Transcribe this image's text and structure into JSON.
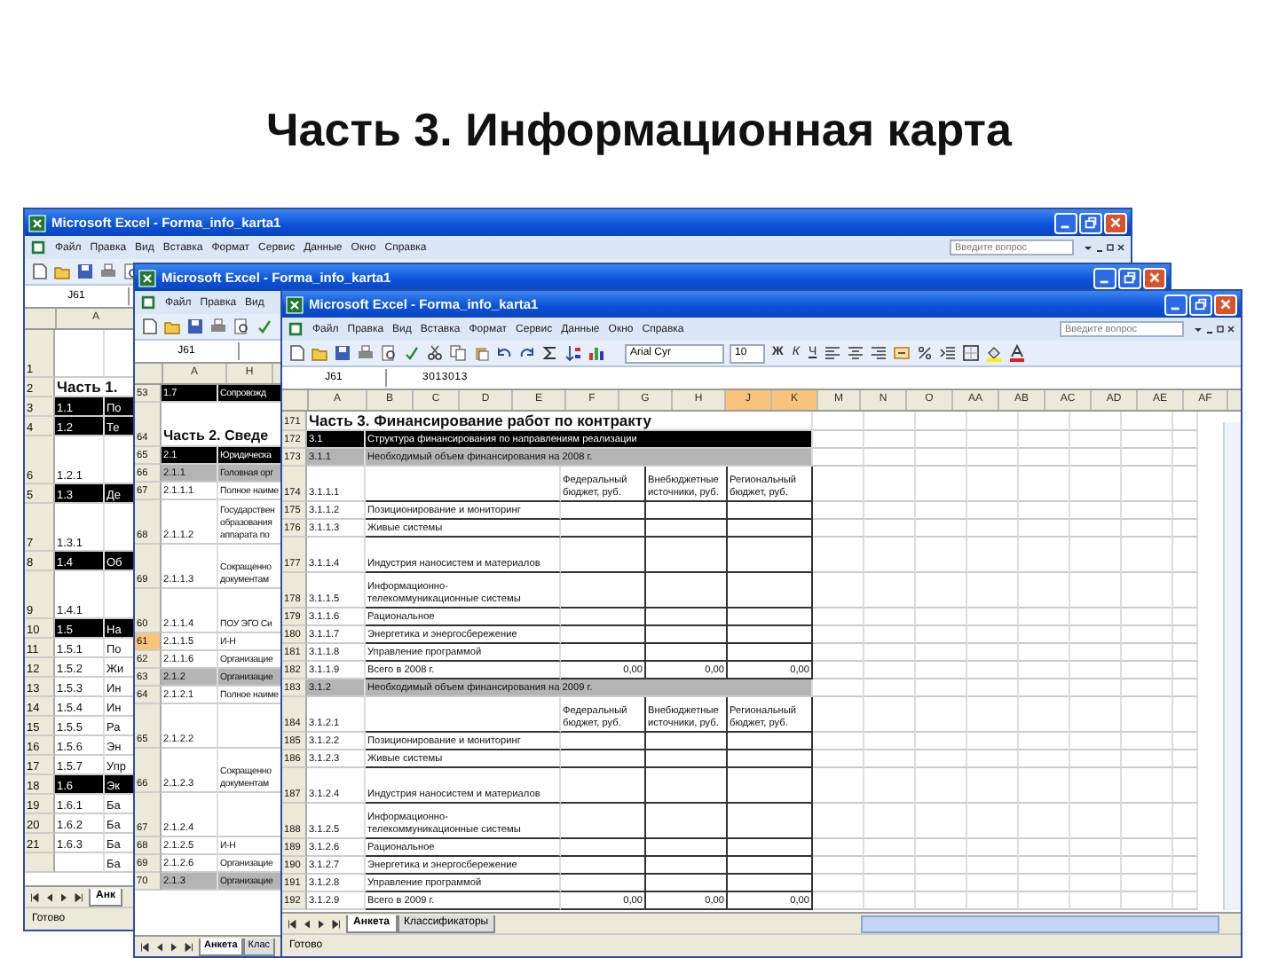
{
  "slide_title": "Часть 3. Информационная карта",
  "windows": [
    {
      "title": "Microsoft Excel - Forma_info_karta1",
      "menu": [
        "Файл",
        "Правка",
        "Вид",
        "Вставка",
        "Формат",
        "Сервис",
        "Данные",
        "Окно",
        "Справка"
      ],
      "ask_placeholder": "Введите вопрос",
      "name_box": "J61",
      "columns": [
        {
          "label": "A",
          "selected": false
        }
      ],
      "rows": [
        {
          "num": "1",
          "kind": "blank",
          "tall": true
        },
        {
          "num": "2",
          "text": "Часть 1.",
          "kind": "heading",
          "tall": false
        },
        {
          "num": "3",
          "code": "1.1",
          "text": "По",
          "kind": "section",
          "tall": false
        },
        {
          "num": "4",
          "code": "1.2",
          "text": "Те",
          "kind": "section",
          "tall": false
        },
        {
          "num": "6",
          "code": "1.2.1",
          "kind": "data",
          "tall": true
        },
        {
          "num": "5",
          "code": "1.3",
          "text": "Де",
          "kind": "section",
          "tall": false
        },
        {
          "num": "7",
          "code": "1.3.1",
          "kind": "data",
          "tall": true
        },
        {
          "num": "8",
          "code": "1.4",
          "text": "Об",
          "kind": "section",
          "tall": false
        },
        {
          "num": "9",
          "code": "1.4.1",
          "kind": "data",
          "tall": true
        },
        {
          "num": "10",
          "code": "1.5",
          "text": "На",
          "kind": "section",
          "tall": false
        },
        {
          "num": "11",
          "code": "1.5.1",
          "text": "По",
          "kind": "data",
          "tall": false
        },
        {
          "num": "12",
          "code": "1.5.2",
          "text": "Жи",
          "kind": "data",
          "tall": false
        },
        {
          "num": "13",
          "code": "1.5.3",
          "text": "Ин",
          "kind": "data",
          "tall": false
        },
        {
          "num": "14",
          "code": "1.5.4",
          "text": "Ин",
          "kind": "data",
          "tall": false
        },
        {
          "num": "15",
          "code": "1.5.5",
          "text": "Ра",
          "kind": "data",
          "tall": false
        },
        {
          "num": "16",
          "code": "1.5.6",
          "text": "Эн",
          "kind": "data",
          "tall": false
        },
        {
          "num": "17",
          "code": "1.5.7",
          "text": "Упр",
          "kind": "data",
          "tall": false
        },
        {
          "num": "18",
          "code": "1.6",
          "text": "Эк",
          "kind": "section",
          "tall": false
        },
        {
          "num": "19",
          "code": "1.6.1",
          "text": "Ба",
          "kind": "data",
          "tall": false
        },
        {
          "num": "20",
          "code": "1.6.2",
          "text": "Ба",
          "kind": "data",
          "tall": false
        },
        {
          "num": "21",
          "code": "1.6.3",
          "text": "Ба",
          "kind": "data",
          "tall": false
        },
        {
          "text": "Ба",
          "kind": "data",
          "tall": false
        }
      ],
      "sheet_tabs": [
        {
          "label": "Анк",
          "selected": true
        }
      ],
      "status": "Готово"
    },
    {
      "title": "Microsoft Excel - Forma_info_karta1",
      "menu": [
        "Файл",
        "Правка",
        "Вид"
      ],
      "name_box": "J61",
      "columns": [
        {
          "label": "A",
          "selected": false
        },
        {
          "label": "H",
          "selected": false
        }
      ],
      "rows": [
        {
          "num": "53",
          "code": "1.7",
          "text": "Сопровожд",
          "kind": "section",
          "tall": false,
          "selected": false
        },
        {
          "num": "64",
          "text": "Часть 2. Сведе",
          "kind": "heading",
          "tall": true,
          "selected": false
        },
        {
          "num": "65",
          "code": "2.1",
          "text": "Юридическа",
          "kind": "section",
          "tall": false,
          "selected": false
        },
        {
          "num": "66",
          "code": "2.1.1",
          "text": "Головная орг",
          "kind": "subsection",
          "tall": false,
          "selected": false
        },
        {
          "num": "67",
          "code": "2.1.1.1",
          "text": "Полное наиме",
          "kind": "data",
          "tall": false,
          "selected": false
        },
        {
          "num": "68",
          "code": "2.1.1.2",
          "text": "Государствен образования аппарата по",
          "kind": "data",
          "tall": true,
          "selected": false
        },
        {
          "num": "69",
          "code": "2.1.1.3",
          "text": "Сокращенно документам",
          "kind": "data",
          "tall": true,
          "selected": false
        },
        {
          "num": "60",
          "code": "2.1.1.4",
          "text": "ПОУ ЭГО Си",
          "kind": "data",
          "tall": true,
          "selected": false
        },
        {
          "num": "61",
          "code": "2.1.1.5",
          "text": "И-Н",
          "kind": "data",
          "tall": false,
          "selected": true
        },
        {
          "num": "62",
          "code": "2.1.1.6",
          "text": "Организацие",
          "kind": "data",
          "tall": false,
          "selected": false
        },
        {
          "num": "63",
          "code": "2.1.2",
          "text": "Организацие",
          "kind": "subsection",
          "tall": false,
          "selected": false
        },
        {
          "num": "64",
          "code": "2.1.2.1",
          "text": "Полное наиме",
          "kind": "data",
          "tall": false,
          "selected": false
        },
        {
          "num": "65",
          "code": "2.1.2.2",
          "kind": "data",
          "tall": true,
          "selected": false
        },
        {
          "num": "66",
          "code": "2.1.2.3",
          "text": "Сокращенно документам",
          "kind": "data",
          "tall": true,
          "selected": false
        },
        {
          "num": "67",
          "code": "2.1.2.4",
          "kind": "data",
          "tall": true,
          "selected": false
        },
        {
          "num": "68",
          "code": "2.1.2.5",
          "text": "И-Н",
          "kind": "data",
          "tall": false,
          "selected": false
        },
        {
          "num": "69",
          "code": "2.1.2.6",
          "text": "Организацие",
          "kind": "data",
          "tall": false,
          "selected": false
        },
        {
          "num": "70",
          "code": "2.1.3",
          "text": "Организацие",
          "kind": "subsection",
          "tall": false,
          "selected": false
        }
      ],
      "sheet_tabs": [
        {
          "label": "Анкета",
          "selected": true
        },
        {
          "label": "Клас",
          "selected": false
        }
      ]
    },
    {
      "title": "Microsoft Excel - Forma_info_karta1",
      "menu": [
        "Файл",
        "Правка",
        "Вид",
        "Вставка",
        "Формат",
        "Сервис",
        "Данные",
        "Окно",
        "Справка"
      ],
      "ask_placeholder": "Введите вопрос",
      "name_box": "J61",
      "formula": "3013013",
      "font_name": "Arial Cyr",
      "font_size": "10",
      "format_buttons": [
        "Ж",
        "К",
        "Ч"
      ],
      "columns": [
        {
          "label": "A",
          "selected": false
        },
        {
          "label": "B",
          "selected": false
        },
        {
          "label": "C",
          "selected": false
        },
        {
          "label": "D",
          "selected": false
        },
        {
          "label": "E",
          "selected": false
        },
        {
          "label": "F",
          "selected": false
        },
        {
          "label": "G",
          "selected": false
        },
        {
          "label": "H",
          "selected": false
        },
        {
          "label": "J",
          "selected": true
        },
        {
          "label": "K",
          "selected": true
        },
        {
          "label": "M",
          "selected": false
        },
        {
          "label": "N",
          "selected": false
        },
        {
          "label": "O",
          "selected": false
        },
        {
          "label": "AA",
          "selected": false
        },
        {
          "label": "AB",
          "selected": false
        },
        {
          "label": "AC",
          "selected": false
        },
        {
          "label": "AD",
          "selected": false
        },
        {
          "label": "AE",
          "selected": false
        },
        {
          "label": "AF",
          "selected": false
        }
      ],
      "rows": [
        {
          "num": "171",
          "text": "Часть 3. Финансирование работ по контракту",
          "kind": "heading",
          "tall": false
        },
        {
          "num": "172",
          "code": "3.1",
          "text": "Структура финансирования по направлениям реализации",
          "kind": "section",
          "tall": false
        },
        {
          "num": "173",
          "code": "3.1.1",
          "text": "Необходимый объем финансирования на 2008 г.",
          "kind": "subsection",
          "tall": false
        },
        {
          "num": "174",
          "code": "3.1.1.1",
          "kind": "header",
          "tall": true,
          "values": [
            "Федеральный бюджет, руб.",
            "Внебюджетные источники, руб.",
            "Региональный бюджет, руб."
          ]
        },
        {
          "num": "175",
          "code": "3.1.1.2",
          "text": "Позиционирование и мониторинг",
          "kind": "data",
          "tall": false
        },
        {
          "num": "176",
          "code": "3.1.1.3",
          "text": "Живые системы",
          "kind": "data",
          "tall": false
        },
        {
          "num": "177",
          "code": "3.1.1.4",
          "text": "Индустрия наносистем и материалов",
          "kind": "data",
          "tall": true
        },
        {
          "num": "178",
          "code": "3.1.1.5",
          "text": "Информационно-телекоммуникационные системы",
          "kind": "data",
          "tall": true
        },
        {
          "num": "179",
          "code": "3.1.1.6",
          "text": "Рациональное",
          "kind": "data",
          "tall": false
        },
        {
          "num": "180",
          "code": "3.1.1.7",
          "text": "Энергетика и энергосбережение",
          "kind": "data",
          "tall": false
        },
        {
          "num": "181",
          "code": "3.1.1.8",
          "text": "Управление программой",
          "kind": "data",
          "tall": false
        },
        {
          "num": "182",
          "code": "3.1.1.9",
          "text": "Всего в 2008 г.",
          "kind": "total",
          "tall": false,
          "values": [
            "0,00",
            "0,00",
            "0,00"
          ]
        },
        {
          "num": "183",
          "code": "3.1.2",
          "text": "Необходимый объем финансирования на 2009 г.",
          "kind": "subsection",
          "tall": false
        },
        {
          "num": "184",
          "code": "3.1.2.1",
          "kind": "header",
          "tall": true,
          "values": [
            "Федеральный бюджет, руб.",
            "Внебюджетные источники, руб.",
            "Региональный бюджет, руб."
          ]
        },
        {
          "num": "185",
          "code": "3.1.2.2",
          "text": "Позиционирование и мониторинг",
          "kind": "data",
          "tall": false
        },
        {
          "num": "186",
          "code": "3.1.2.3",
          "text": "Живые системы",
          "kind": "data",
          "tall": false
        },
        {
          "num": "187",
          "code": "3.1.2.4",
          "text": "Индустрия наносистем и материалов",
          "kind": "data",
          "tall": true
        },
        {
          "num": "188",
          "code": "3.1.2.5",
          "text": "Информационно-телекоммуникационные системы",
          "kind": "data",
          "tall": true
        },
        {
          "num": "189",
          "code": "3.1.2.6",
          "text": "Рациональное",
          "kind": "data",
          "tall": false
        },
        {
          "num": "190",
          "code": "3.1.2.7",
          "text": "Энергетика и энергосбережение",
          "kind": "data",
          "tall": false
        },
        {
          "num": "191",
          "code": "3.1.2.8",
          "text": "Управление программой",
          "kind": "data",
          "tall": false
        },
        {
          "num": "192",
          "code": "3.1.2.9",
          "text": "Всего в 2009 г.",
          "kind": "total",
          "tall": false,
          "values": [
            "0,00",
            "0,00",
            "0,00"
          ]
        }
      ],
      "sheet_tabs": [
        {
          "label": "Анкета",
          "selected": true
        },
        {
          "label": "Классификаторы",
          "selected": false
        }
      ],
      "status": "Готово"
    }
  ]
}
